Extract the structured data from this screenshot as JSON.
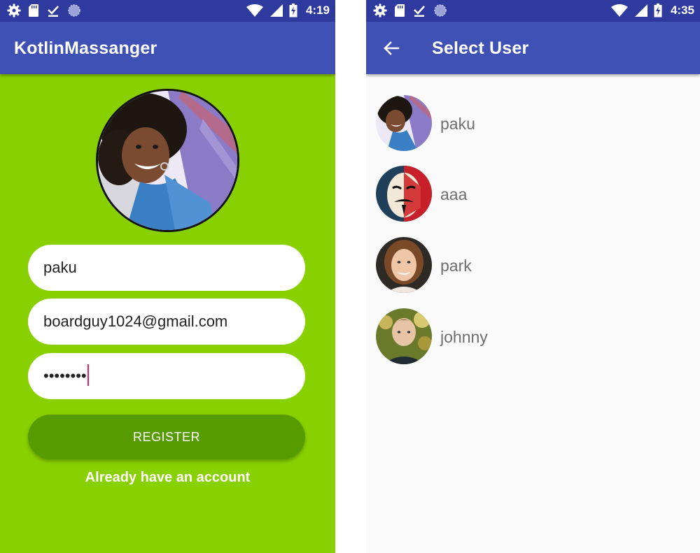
{
  "register_screen": {
    "status_bar": {
      "time": "4:19"
    },
    "app_bar": {
      "title": "KotlinMassanger"
    },
    "form": {
      "username_value": "paku",
      "email_value": "boardguy1024@gmail.com",
      "password_value": "••••••••",
      "register_label": "REGISTER",
      "login_link": "Already have an account"
    },
    "colors": {
      "background": "#88d000",
      "button": "#569c00",
      "caret": "#e91e63"
    }
  },
  "select_user_screen": {
    "status_bar": {
      "time": "4:35"
    },
    "app_bar": {
      "title": "Select User"
    },
    "users": [
      {
        "name": "paku"
      },
      {
        "name": "aaa"
      },
      {
        "name": "park"
      },
      {
        "name": "johnny"
      }
    ],
    "colors": {
      "app_bar": "#3f51b5",
      "status_bar": "#2f3a9e"
    }
  }
}
